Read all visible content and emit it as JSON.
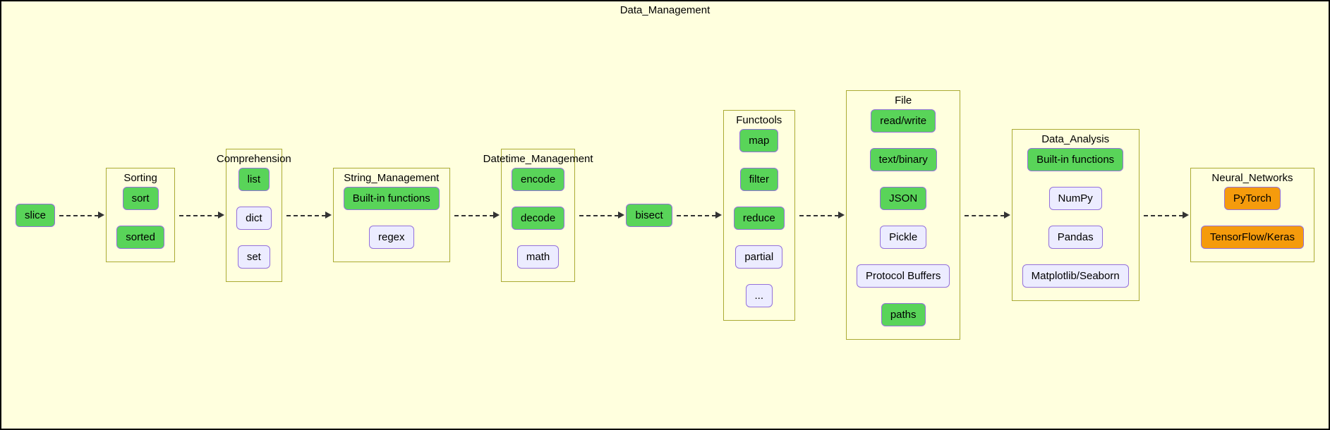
{
  "container_label": "Data_Management",
  "slice": "slice",
  "bisect": "bisect",
  "groups": {
    "sorting": {
      "label": "Sorting",
      "items": [
        "sort",
        "sorted"
      ]
    },
    "comprehension": {
      "label": "Comprehension",
      "items": [
        "list",
        "dict",
        "set"
      ]
    },
    "string": {
      "label": "String_Management",
      "items": [
        "Built-in functions",
        "regex"
      ]
    },
    "datetime": {
      "label": "Datetime_Management",
      "items": [
        "encode",
        "decode",
        "math"
      ]
    },
    "functools": {
      "label": "Functools",
      "items": [
        "map",
        "filter",
        "reduce",
        "partial",
        "..."
      ]
    },
    "file": {
      "label": "File",
      "items": [
        "read/write",
        "text/binary",
        "JSON",
        "Pickle",
        "Protocol Buffers",
        "paths"
      ]
    },
    "analysis": {
      "label": "Data_Analysis",
      "items": [
        "Built-in functions",
        "NumPy",
        "Pandas",
        "Matplotlib/Seaborn"
      ]
    },
    "nn": {
      "label": "Neural_Networks",
      "items": [
        "PyTorch",
        "TensorFlow/Keras"
      ]
    }
  },
  "node_styles": {
    "slice": "green",
    "bisect": "green",
    "sorting": [
      "green",
      "green"
    ],
    "comprehension": [
      "green",
      "plain",
      "plain"
    ],
    "string": [
      "green",
      "plain"
    ],
    "datetime": [
      "green",
      "green",
      "plain"
    ],
    "functools": [
      "green",
      "green",
      "green",
      "plain",
      "plain"
    ],
    "file": [
      "green",
      "green",
      "green",
      "plain",
      "plain",
      "green"
    ],
    "analysis": [
      "green",
      "plain",
      "plain",
      "plain"
    ],
    "nn": [
      "orange",
      "orange"
    ]
  }
}
